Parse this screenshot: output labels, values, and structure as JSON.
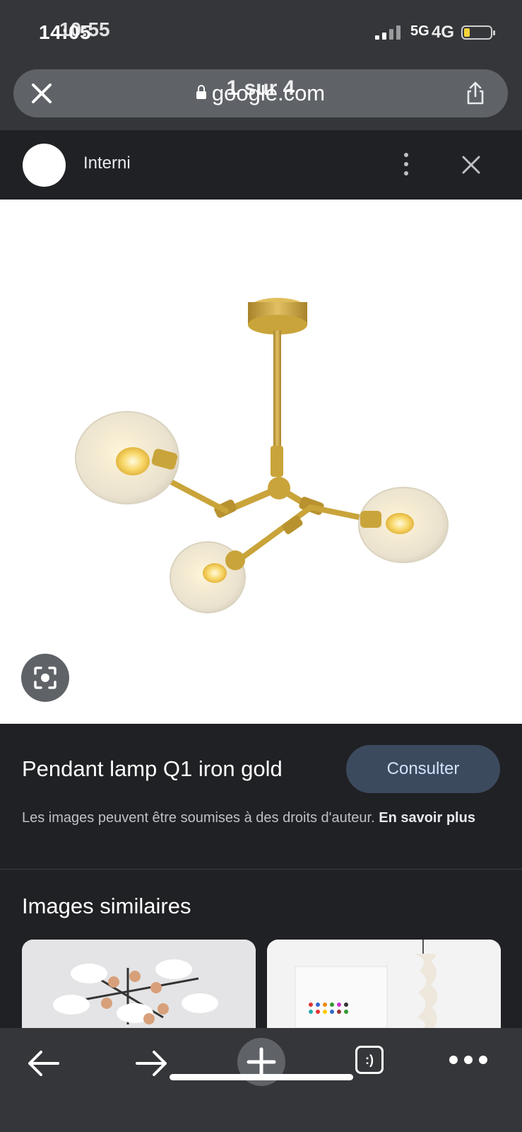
{
  "status_bar": {
    "time": "14:05",
    "time_overlay": "10:55",
    "network": "5G",
    "network_overlay": "4G",
    "battery_color": "#f5d33a"
  },
  "browser": {
    "url": "google.com",
    "page_counter": "1 sur 4",
    "close_icon": "close-icon",
    "share_icon": "share-icon",
    "lock_icon": "lock-icon"
  },
  "site": {
    "name": "Interni",
    "more_icon": "more-vert-icon",
    "close_icon": "close-icon"
  },
  "image": {
    "subject": "gold pendant lamp with three glass globes",
    "lens_icon": "lens-search-icon"
  },
  "details": {
    "title": "Pendant lamp Q1 iron gold",
    "visit_label": "Consulter",
    "copyright_text": "Les images peuvent être soumises à des droits d'auteur.",
    "learn_more_label": "En savoir plus"
  },
  "similar": {
    "heading": "Images similaires"
  },
  "toolbar": {
    "back_icon": "arrow-left-icon",
    "forward_icon": "arrow-right-icon",
    "new_tab_icon": "plus-icon",
    "tabs_label": ":)",
    "menu_icon": "more-horiz-icon"
  },
  "colors": {
    "background": "#202124",
    "chrome": "#35363a",
    "pill": "#5f6368",
    "button": "#3c4a5e",
    "button_text": "#d2e3fc",
    "brass": "#c9a43a"
  }
}
